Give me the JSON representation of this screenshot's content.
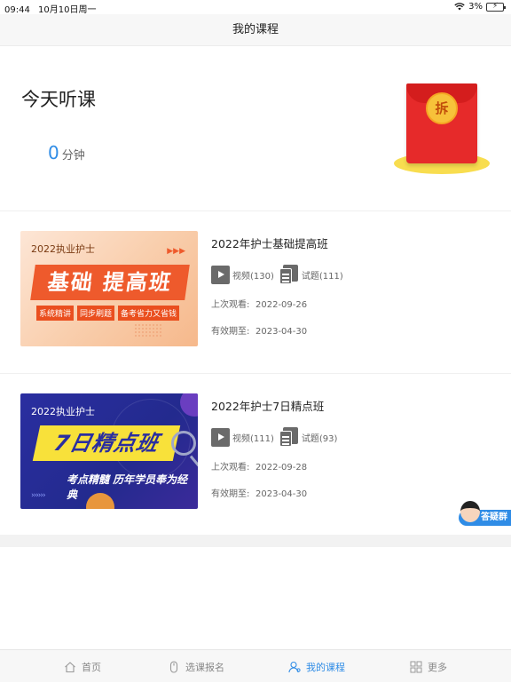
{
  "status_bar": {
    "time": "09:44",
    "date": "10月10日周一",
    "battery": "3%"
  },
  "nav": {
    "title": "我的课程"
  },
  "today": {
    "title": "今天听课",
    "minutes": "0",
    "unit": "分钟",
    "redpack_label": "拆"
  },
  "courses": [
    {
      "title": "2022年护士基础提高班",
      "thumb": {
        "tag": "2022执业护士",
        "big": "基础 提高班",
        "subs": [
          "系统精讲",
          "同步刷题",
          "备考省力又省钱"
        ]
      },
      "video": "视频(130)",
      "quiz": "试题(111)",
      "last_label": "上次观看:",
      "last": "2022-09-26",
      "valid_label": "有效期至:",
      "valid": "2023-04-30"
    },
    {
      "title": "2022年护士7日精点班",
      "thumb": {
        "tag": "2022执业护士",
        "big": "7日精点班",
        "subs": [
          "考点精髓  历年学员奉为经典"
        ]
      },
      "video": "视频(111)",
      "quiz": "试题(93)",
      "last_label": "上次观看:",
      "last": "2022-09-28",
      "valid_label": "有效期至:",
      "valid": "2023-04-30"
    }
  ],
  "float_button": {
    "label": "答疑群"
  },
  "tabs": [
    {
      "label": "首页",
      "icon": "home-icon",
      "active": false
    },
    {
      "label": "选课报名",
      "icon": "mouse-icon",
      "active": false
    },
    {
      "label": "我的课程",
      "icon": "user-icon",
      "active": true
    },
    {
      "label": "更多",
      "icon": "grid-icon",
      "active": false
    }
  ],
  "colors": {
    "accent": "#2f8ce6",
    "redpack": "#e62a2a",
    "coin": "#f7c23a"
  }
}
